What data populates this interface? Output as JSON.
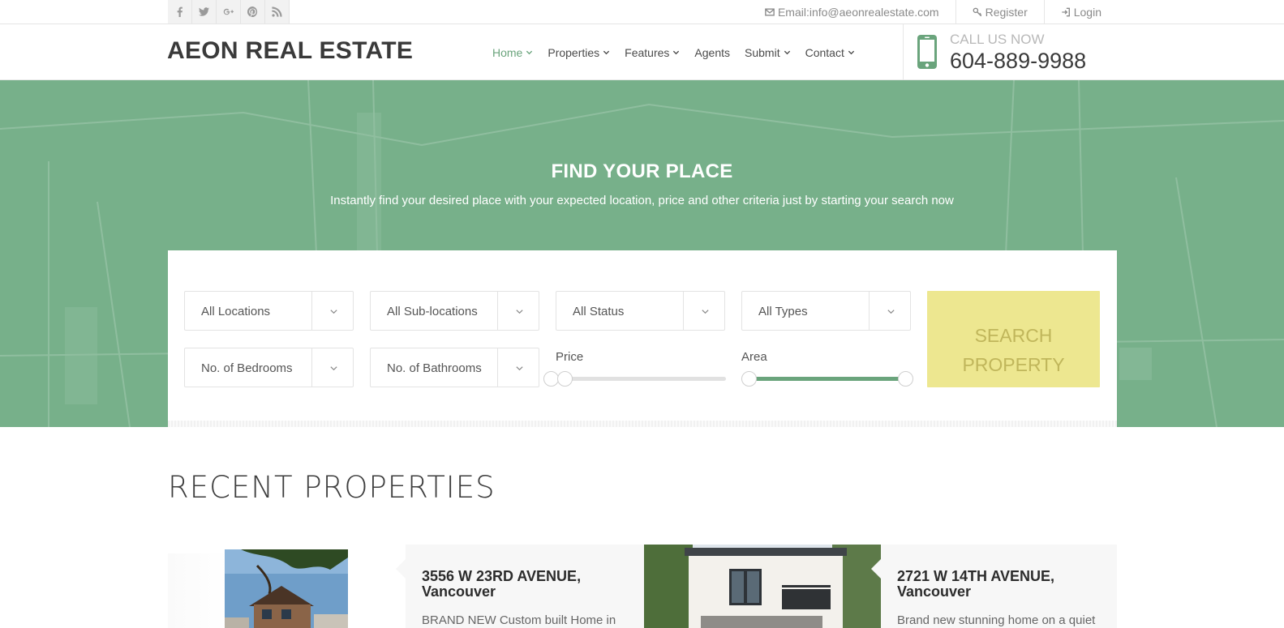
{
  "topbar": {
    "social": [
      "facebook-icon",
      "twitter-icon",
      "google-plus-icon",
      "pinterest-icon",
      "rss-icon"
    ],
    "email": "Email:info@aeonrealestate.com",
    "register": "Register",
    "login": "Login"
  },
  "header": {
    "logo": "AEON REAL ESTATE",
    "nav": [
      {
        "label": "Home",
        "dropdown": true,
        "active": true
      },
      {
        "label": "Properties",
        "dropdown": true
      },
      {
        "label": "Features",
        "dropdown": true
      },
      {
        "label": "Agents",
        "dropdown": false
      },
      {
        "label": "Submit",
        "dropdown": true
      },
      {
        "label": "Contact",
        "dropdown": true
      }
    ],
    "call_label": "CALL US NOW",
    "call_number": "604-889-9988"
  },
  "hero": {
    "title": "FIND YOUR PLACE",
    "subtitle": "Instantly find your desired place with your expected location, price and other criteria just by starting your search now"
  },
  "search": {
    "locations": "All Locations",
    "sub_locations": "All Sub-locations",
    "status": "All Status",
    "types": "All Types",
    "bedrooms": "No. of Bedrooms",
    "bathrooms": "No. of Bathrooms",
    "price_label": "Price",
    "area_label": "Area",
    "button_line1": "SEARCH",
    "button_line2": "PROPERTY"
  },
  "recent": {
    "title": "RECENT PROPERTIES",
    "cards": [
      {
        "title_line1": "3556 W 23RD AVENUE,",
        "title_line2": "Vancouver",
        "desc": "BRAND NEW Custom built Home in"
      },
      {
        "title_line1": "2721 W 14TH AVENUE,",
        "title_line2": "Vancouver",
        "desc": "Brand new stunning home on a quiet"
      }
    ]
  },
  "colors": {
    "accent": "#6aa47c",
    "hero_bg": "#77b08a",
    "search_button": "#ede790",
    "search_button_text": "#c0b65b"
  }
}
